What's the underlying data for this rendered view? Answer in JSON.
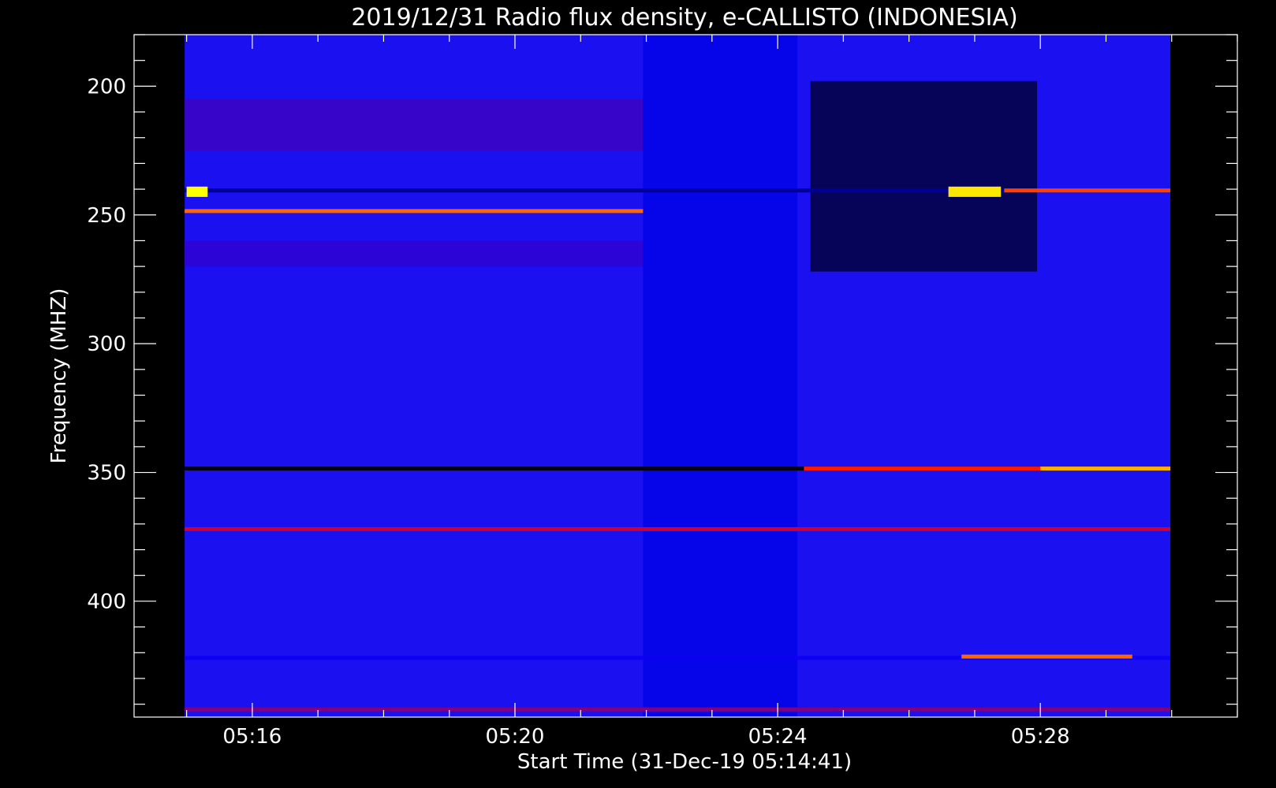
{
  "chart_data": {
    "type": "heatmap",
    "title": "2019/12/31  Radio flux density, e-CALLISTO (INDONESIA)",
    "xlabel": "Start Time (31-Dec-19 05:14:41)",
    "ylabel": "Frequency (MHZ)",
    "x_unit": "minutes after 05:00 UT",
    "xlim": [
      14.2,
      31.0
    ],
    "ylim": [
      180,
      445
    ],
    "y_inverted": true,
    "data_x_range": [
      14.97,
      29.98
    ],
    "data_y_range": [
      180,
      445
    ],
    "x_ticks": [
      {
        "value": 16,
        "label": "05:16"
      },
      {
        "value": 20,
        "label": "05:20"
      },
      {
        "value": 24,
        "label": "05:24"
      },
      {
        "value": 28,
        "label": "05:28"
      }
    ],
    "y_ticks": [
      {
        "value": 200,
        "label": "200"
      },
      {
        "value": 250,
        "label": "250"
      },
      {
        "value": 300,
        "label": "300"
      },
      {
        "value": 350,
        "label": "350"
      },
      {
        "value": 400,
        "label": "400"
      }
    ],
    "colormap": [
      "#000000",
      "#0000ff",
      "#ff0000",
      "#ffff00"
    ],
    "background_color": "#1a10f0",
    "grid": false,
    "regions": [
      {
        "x": [
          14.97,
          21.95
        ],
        "y": [
          205,
          225
        ],
        "level": 0.42
      },
      {
        "x": [
          14.97,
          21.95
        ],
        "y": [
          260,
          270
        ],
        "level": 0.4
      },
      {
        "x": [
          21.95,
          24.3
        ],
        "y": [
          180,
          445
        ],
        "level": 0.3
      },
      {
        "x": [
          24.5,
          27.95
        ],
        "y": [
          198,
          272
        ],
        "level": 0.05
      }
    ],
    "lines": [
      {
        "x": [
          14.97,
          29.98
        ],
        "y": 348.5,
        "level": 0.02
      },
      {
        "x": [
          24.4,
          29.98
        ],
        "y": 348.5,
        "level": 0.7
      },
      {
        "x": [
          28.0,
          29.98
        ],
        "y": 348.5,
        "level": 0.9
      },
      {
        "x": [
          14.97,
          21.95
        ],
        "y": 248.5,
        "level": 0.8
      },
      {
        "x": [
          14.97,
          29.98
        ],
        "y": 372,
        "level": 0.6
      },
      {
        "x": [
          14.97,
          29.98
        ],
        "y": 240.5,
        "level": 0.2
      },
      {
        "x": [
          27.45,
          29.98
        ],
        "y": 240.5,
        "level": 0.75
      },
      {
        "x": [
          14.97,
          29.98
        ],
        "y": 422,
        "level": 0.35
      },
      {
        "x": [
          26.8,
          29.4
        ],
        "y": 421.5,
        "level": 0.8
      },
      {
        "x": [
          14.97,
          29.98
        ],
        "y": 442,
        "level": 0.5
      }
    ],
    "hotspots": [
      {
        "x": [
          15.0,
          15.32
        ],
        "y": [
          239,
          243
        ],
        "level": 1.0
      },
      {
        "x": [
          26.6,
          27.4
        ],
        "y": [
          239,
          243
        ],
        "level": 0.97
      }
    ]
  }
}
